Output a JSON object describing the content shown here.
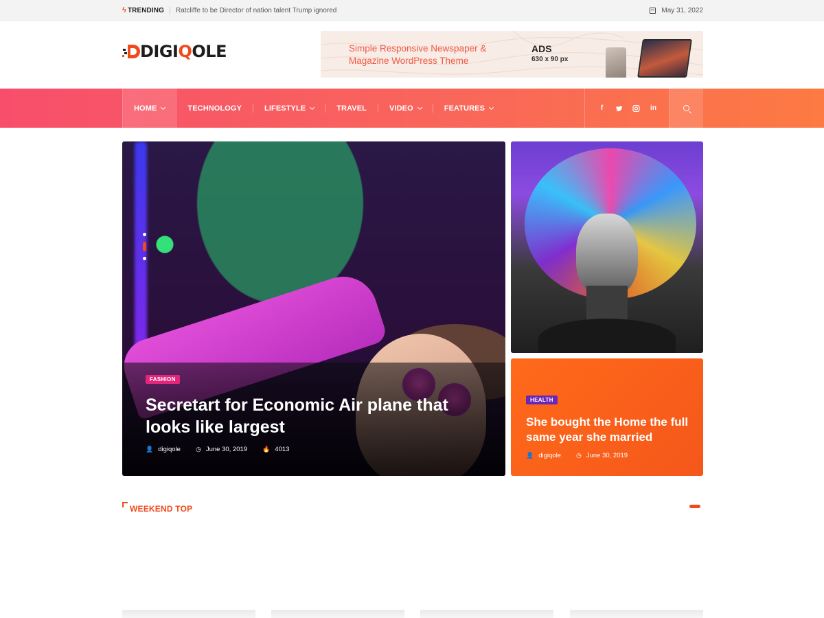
{
  "topbar": {
    "trending_label": "TRENDING",
    "trending_text": "Ratcliffe to be Director of nation talent Trump ignored",
    "date": "May 31, 2022"
  },
  "logo": {
    "text_start": "DIGI",
    "text_q": "Q",
    "text_end": "OLE"
  },
  "ad": {
    "title": "Simple Responsive Newspaper & Magazine WordPress Theme",
    "label": "ADS",
    "size": "630 x 90 px"
  },
  "nav": {
    "items": [
      {
        "label": "HOME",
        "dropdown": true,
        "active": true
      },
      {
        "label": "TECHNOLOGY",
        "dropdown": false
      },
      {
        "label": "LIFESTYLE",
        "dropdown": true
      },
      {
        "label": "TRAVEL",
        "dropdown": false
      },
      {
        "label": "VIDEO",
        "dropdown": true
      },
      {
        "label": "FEATURES",
        "dropdown": true
      }
    ],
    "social": [
      "f",
      "t",
      "ig",
      "in"
    ]
  },
  "hero": {
    "category": "FASHION",
    "title": "Secretart for Economic Air plane that looks like largest",
    "author": "digiqole",
    "date": "June 30, 2019",
    "views": "4013"
  },
  "side_post": {
    "category": "HEALTH",
    "title": "She bought the Home the full same year she married",
    "author": "digiqole",
    "date": "June 30, 2019"
  },
  "weekend": {
    "title": "WEEKEND TOP"
  },
  "colors": {
    "accent": "#f0491b",
    "nav_start": "#f84e6c",
    "nav_end": "#fd7a42",
    "fashion_tag": "#e3267c",
    "health_tag": "#6a26b4"
  }
}
